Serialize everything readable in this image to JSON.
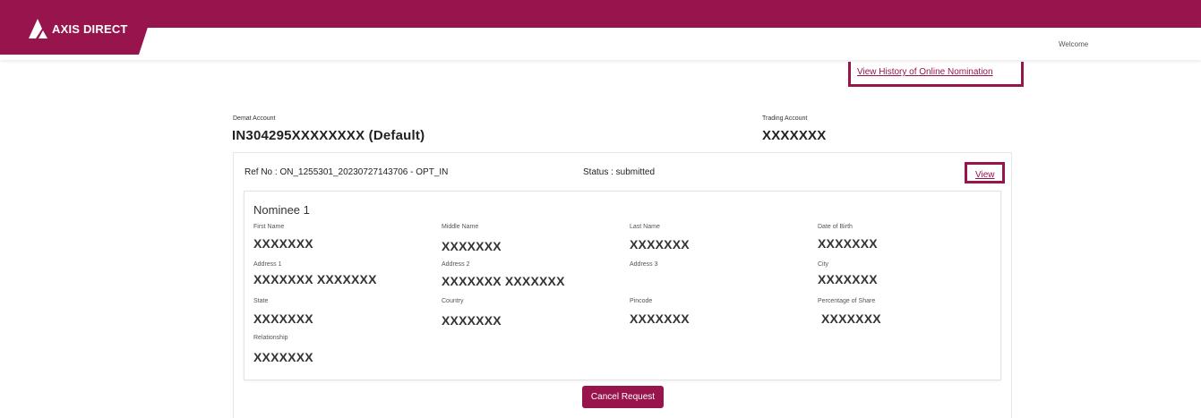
{
  "header": {
    "brand": "AXIS DIRECT",
    "welcome": "Welcome"
  },
  "history_link": "View History of Online Nomination",
  "demat": {
    "label": "Demat Account",
    "value": "IN304295XXXXXXXX (Default)"
  },
  "trading": {
    "label": "Trading Account",
    "value": "XXXXXXX"
  },
  "request": {
    "ref": "Ref No : ON_1255301_20230727143706 - OPT_IN",
    "status": "Status : submitted",
    "view_label": "View"
  },
  "nominee": {
    "title": "Nominee 1",
    "fields": {
      "first_name": {
        "label": "First Name",
        "value": "XXXXXXX"
      },
      "middle_name": {
        "label": "Middle Name",
        "value": "XXXXXXX"
      },
      "last_name": {
        "label": "Last Name",
        "value": "XXXXXXX"
      },
      "dob": {
        "label": "Date of Birth",
        "value": "XXXXXXX"
      },
      "address1": {
        "label": "Address 1",
        "value": "XXXXXXX XXXXXXX"
      },
      "address2": {
        "label": "Address 2",
        "value": "XXXXXXX XXXXXXX"
      },
      "address3": {
        "label": "Address 3",
        "value": ""
      },
      "city": {
        "label": "City",
        "value": "XXXXXXX"
      },
      "state": {
        "label": "State",
        "value": "XXXXXXX"
      },
      "country": {
        "label": "Country",
        "value": "XXXXXXX"
      },
      "pincode": {
        "label": "Pincode",
        "value": "XXXXXXX"
      },
      "share": {
        "label": "Percentage of Share",
        "value": "XXXXXXX"
      },
      "relationship": {
        "label": "Relationship",
        "value": "XXXXXXX"
      }
    }
  },
  "cancel_label": "Cancel Request",
  "colors": {
    "brand": "#97144d"
  }
}
